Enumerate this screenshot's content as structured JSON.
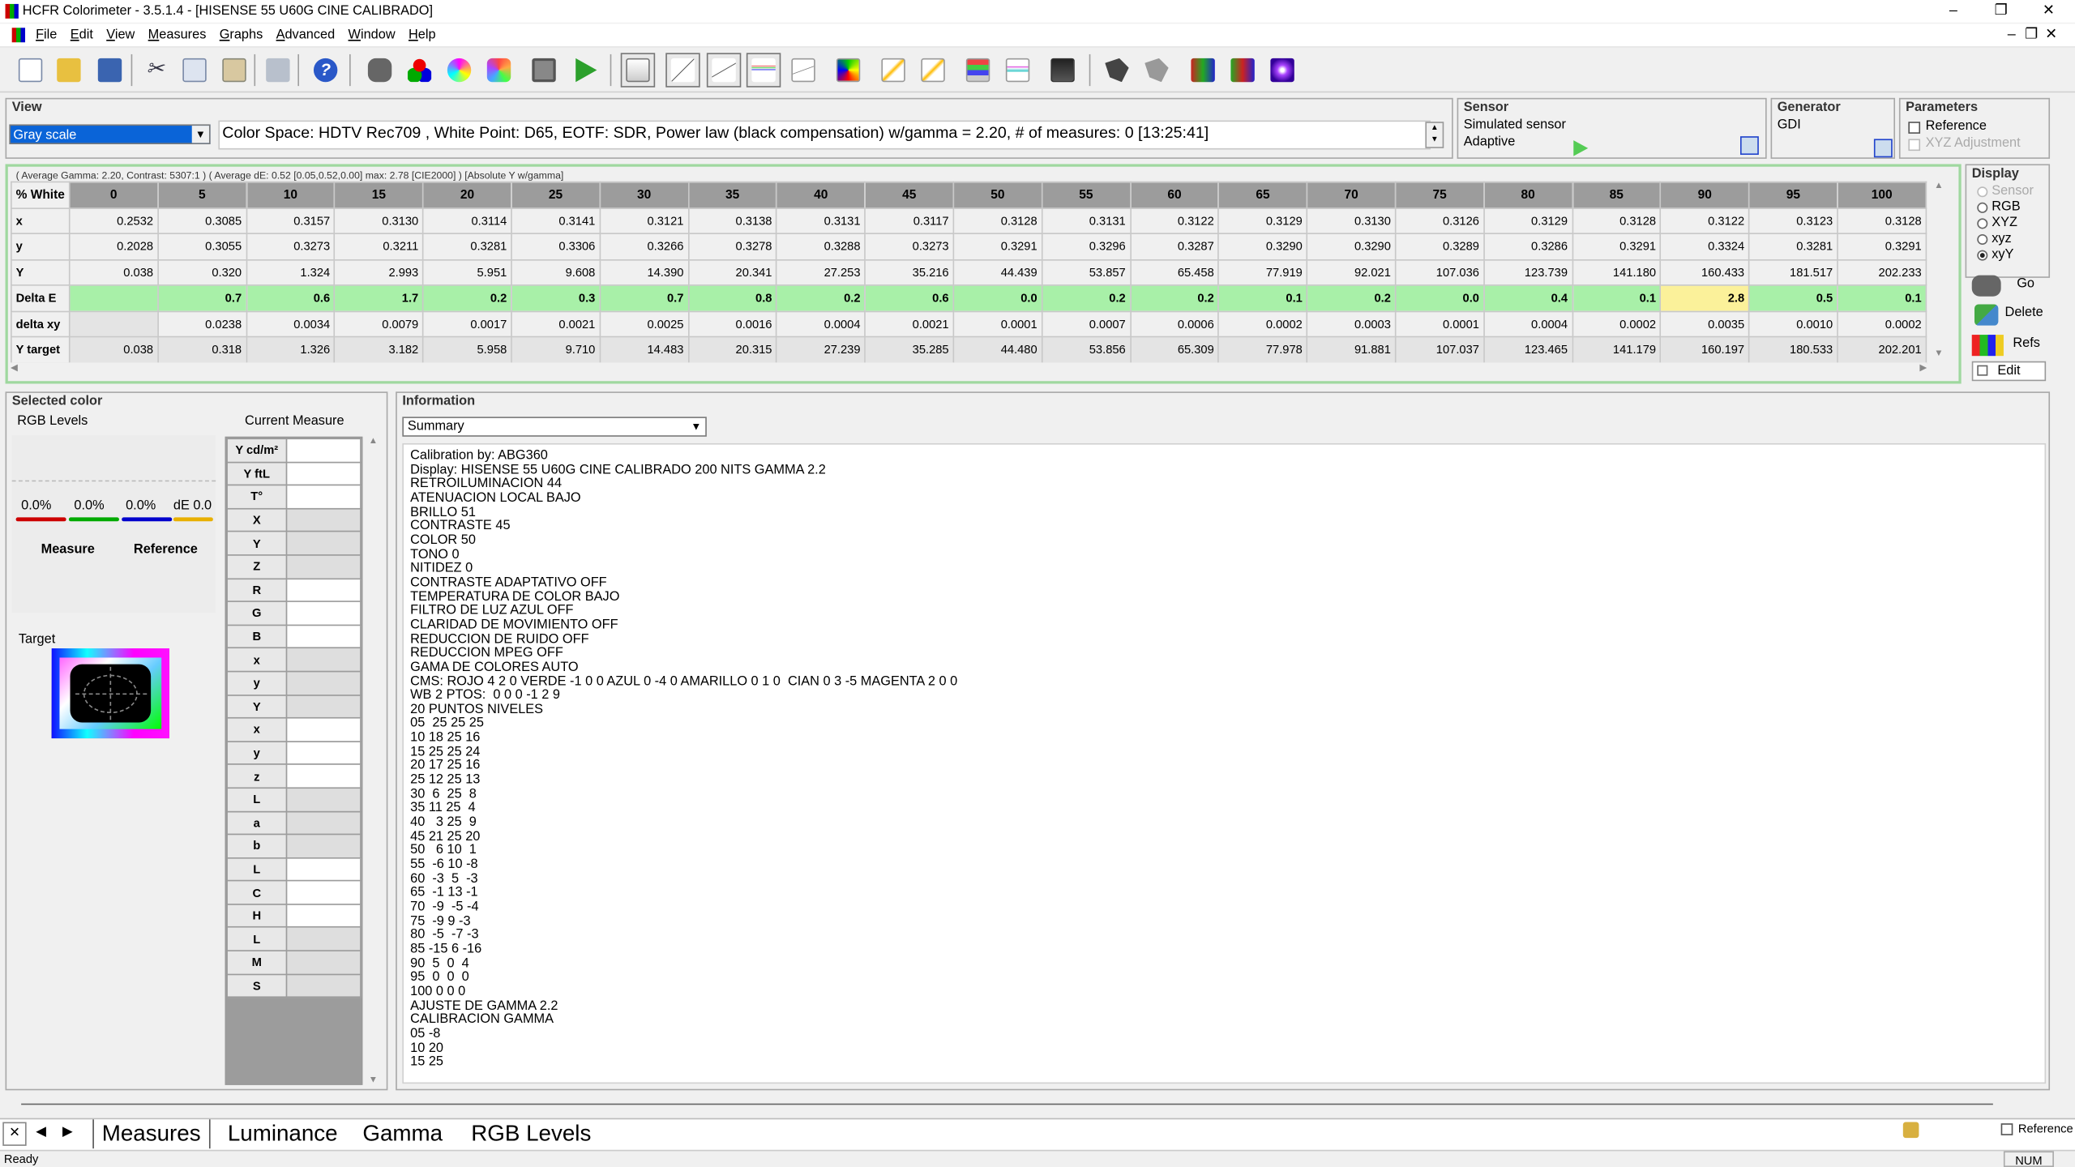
{
  "window": {
    "title": "HCFR Colorimeter - 3.5.1.4 - [HISENSE 55 U60G CINE CALIBRADO]",
    "min": "–",
    "restore": "❐",
    "close": "✕",
    "doc_min": "–",
    "doc_restore": "❐",
    "doc_close": "✕"
  },
  "menu": [
    "File",
    "Edit",
    "View",
    "Measures",
    "Graphs",
    "Advanced",
    "Window",
    "Help"
  ],
  "view": {
    "label": "View",
    "selected": "Gray scale",
    "info": "Color Space: HDTV Rec709 , White Point: D65, EOTF:  SDR, Power law (black compensation) w/gamma = 2.20, # of measures: 0 [13:25:41]"
  },
  "sensor": {
    "label": "Sensor",
    "name": "Simulated sensor",
    "mode": "Adaptive"
  },
  "generator": {
    "label": "Generator",
    "name": "GDI"
  },
  "parameters": {
    "label": "Parameters",
    "reference": "Reference",
    "xyz_adjust": "XYZ Adjustment"
  },
  "summary_line": "( Average Gamma: 2.20, Contrast: 5307:1 ) ( Average dE: 0.52 [0.05,0.52,0.00] max: 2.78 [CIE2000] ) [Absolute Y w/gamma]",
  "grid": {
    "columns": [
      "% White",
      "0",
      "5",
      "10",
      "15",
      "20",
      "25",
      "30",
      "35",
      "40",
      "45",
      "50",
      "55",
      "60",
      "65",
      "70",
      "75",
      "80",
      "85",
      "90",
      "95",
      "100"
    ],
    "rows": [
      {
        "label": "x",
        "cells": [
          "0.2532",
          "0.3085",
          "0.3157",
          "0.3130",
          "0.3114",
          "0.3141",
          "0.3121",
          "0.3138",
          "0.3131",
          "0.3117",
          "0.3128",
          "0.3131",
          "0.3122",
          "0.3129",
          "0.3130",
          "0.3126",
          "0.3129",
          "0.3128",
          "0.3122",
          "0.3123",
          "0.3128"
        ]
      },
      {
        "label": "y",
        "cells": [
          "0.2028",
          "0.3055",
          "0.3273",
          "0.3211",
          "0.3281",
          "0.3306",
          "0.3266",
          "0.3278",
          "0.3288",
          "0.3273",
          "0.3291",
          "0.3296",
          "0.3287",
          "0.3290",
          "0.3290",
          "0.3289",
          "0.3286",
          "0.3291",
          "0.3324",
          "0.3281",
          "0.3291"
        ]
      },
      {
        "label": "Y",
        "cells": [
          "0.038",
          "0.320",
          "1.324",
          "2.993",
          "5.951",
          "9.608",
          "14.390",
          "20.341",
          "27.253",
          "35.216",
          "44.439",
          "53.857",
          "65.458",
          "77.919",
          "92.021",
          "107.036",
          "123.739",
          "141.180",
          "160.433",
          "181.517",
          "202.233"
        ]
      },
      {
        "label": "Delta E",
        "cells": [
          "",
          "0.7",
          "0.6",
          "1.7",
          "0.2",
          "0.3",
          "0.7",
          "0.8",
          "0.2",
          "0.6",
          "0.0",
          "0.2",
          "0.2",
          "0.1",
          "0.2",
          "0.0",
          "0.4",
          "0.1",
          "2.8",
          "0.5",
          "0.1"
        ]
      },
      {
        "label": "delta xy",
        "cells": [
          "",
          "0.0238",
          "0.0034",
          "0.0079",
          "0.0017",
          "0.0021",
          "0.0025",
          "0.0016",
          "0.0004",
          "0.0021",
          "0.0001",
          "0.0007",
          "0.0006",
          "0.0002",
          "0.0003",
          "0.0001",
          "0.0004",
          "0.0002",
          "0.0035",
          "0.0010",
          "0.0002"
        ]
      },
      {
        "label": "Y target",
        "cells": [
          "0.038",
          "0.318",
          "1.326",
          "3.182",
          "5.958",
          "9.710",
          "14.483",
          "20.315",
          "27.239",
          "35.285",
          "44.480",
          "53.856",
          "65.309",
          "77.978",
          "91.881",
          "107.037",
          "123.465",
          "141.179",
          "160.197",
          "180.533",
          "202.201"
        ]
      }
    ]
  },
  "display": {
    "label": "Display",
    "options": [
      "Sensor",
      "RGB",
      "XYZ",
      "xyz",
      "xyY"
    ],
    "selected": "xyY"
  },
  "actions": {
    "go": "Go",
    "delete": "Delete",
    "refs": "Refs",
    "edit": "Edit"
  },
  "selected_color": {
    "label": "Selected color",
    "rgb_levels": "RGB Levels",
    "current": "Current Measure",
    "r": "0.0%",
    "g": "0.0%",
    "b": "0.0%",
    "de": "dE 0.0",
    "measure": "Measure",
    "reference": "Reference",
    "target": "Target"
  },
  "measure_labels": [
    "Y cd/m²",
    "Y ftL",
    "T°",
    "X",
    "Y",
    "Z",
    "R",
    "G",
    "B",
    "x",
    "y",
    "Y",
    "x",
    "y",
    "z",
    "L",
    "a",
    "b",
    "L",
    "C",
    "H",
    "L",
    "M",
    "S"
  ],
  "information": {
    "label": "Information",
    "select": "Summary",
    "text": "Calibration by: ABG360\nDisplay: HISENSE 55 U60G CINE CALIBRADO 200 NITS GAMMA 2.2\nRETROILUMINACION 44\nATENUACION LOCAL BAJO\nBRILLO 51\nCONTRASTE 45\nCOLOR 50\nTONO 0\nNITIDEZ 0\nCONTRASTE ADAPTATIVO OFF\nTEMPERATURA DE COLOR BAJO\nFILTRO DE LUZ AZUL OFF\nCLARIDAD DE MOVIMIENTO OFF\nREDUCCION DE RUIDO OFF\nREDUCCION MPEG OFF\nGAMA DE COLORES AUTO\nCMS: ROJO 4 2 0 VERDE -1 0 0 AZUL 0 -4 0 AMARILLO 0 1 0  CIAN 0 3 -5 MAGENTA 2 0 0\nWB 2 PTOS:  0 0 0 -1 2 9\n20 PUNTOS NIVELES\n05  25 25 25\n10 18 25 16\n15 25 25 24\n20 17 25 16\n25 12 25 13\n30  6  25  8\n35 11 25  4\n40   3 25  9\n45 21 25 20\n50   6 10  1\n55  -6 10 -8\n60  -3  5  -3\n65  -1 13 -1\n70  -9  -5 -4\n75  -9 9 -3\n80  -5  -7 -3\n85 -15 6 -16\n90  5  0  4\n95  0  0  0\n100 0 0 0\nAJUSTE DE GAMMA 2.2\nCALIBRACION GAMMA\n05 -8\n10 20\n15 25"
  },
  "tabs": [
    "Measures",
    "Luminance",
    "Gamma",
    "RGB Levels"
  ],
  "status": {
    "left": "Ready",
    "num": "NUM",
    "reference": "Reference"
  }
}
